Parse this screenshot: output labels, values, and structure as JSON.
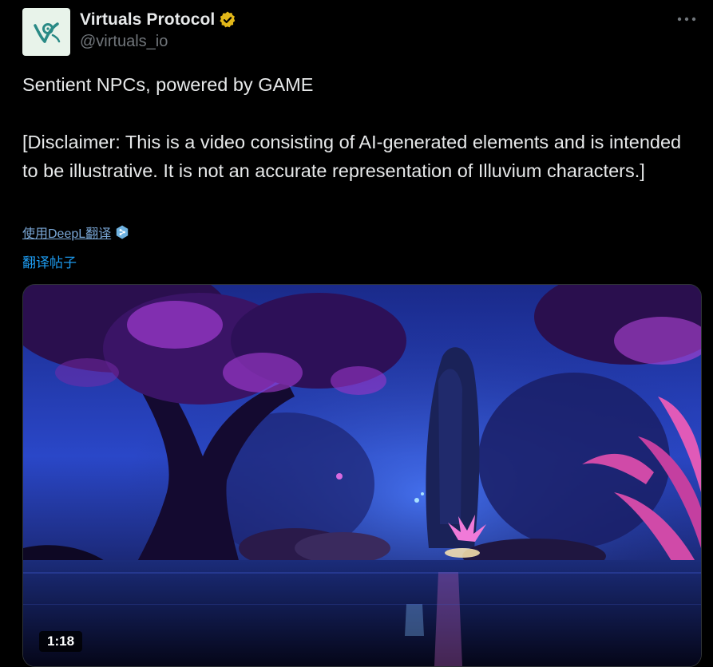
{
  "author": {
    "display_name": "Virtuals Protocol",
    "handle": "@virtuals_io",
    "verified_badge_color": "#e2b719",
    "avatar_icon": "virtuals-logo-icon"
  },
  "menu": {
    "more_icon": "more-horizontal-icon"
  },
  "tweet": {
    "line1": "Sentient NPCs, powered by GAME",
    "line2": "[Disclaimer: This is a video consisting of AI-generated elements and is intended to be illustrative. It is not an accurate representation of Illuvium characters.]"
  },
  "links": {
    "deepl_label": "使用DeepL翻译",
    "deepl_icon": "deepl-icon",
    "translate_post_label": "翻译帖子"
  },
  "media": {
    "type": "video",
    "duration": "1:18"
  },
  "colors": {
    "background": "#000000",
    "text_primary": "#e7e9ea",
    "text_secondary": "#71767b",
    "link": "#1d9bf0"
  }
}
